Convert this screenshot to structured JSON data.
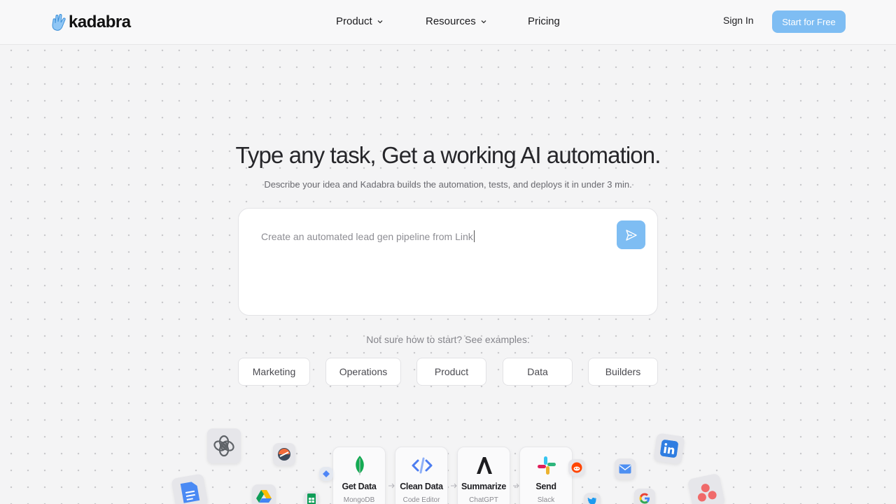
{
  "header": {
    "brand": "kadabra",
    "nav": [
      {
        "label": "Product",
        "has_dropdown": true
      },
      {
        "label": "Resources",
        "has_dropdown": true
      },
      {
        "label": "Pricing",
        "has_dropdown": false
      }
    ],
    "sign_in": "Sign In",
    "cta": "Start for Free"
  },
  "hero": {
    "title": "Type any task, Get a working AI automation.",
    "subtitle": "Describe your idea and Kadabra builds the automation, tests, and deploys it in under 3 min.",
    "prompt_value": "Create an automated lead gen pipeline from Link",
    "send_icon": "send-icon"
  },
  "examples": {
    "label": "Not sure how to start? See examples:",
    "chips": [
      "Marketing",
      "Operations",
      "Product",
      "Data",
      "Builders"
    ]
  },
  "workflow": [
    {
      "title": "Get Data",
      "app": "MongoDB",
      "icon": "mongodb-icon"
    },
    {
      "title": "Clean Data",
      "app": "Code Editor",
      "icon": "code-icon"
    },
    {
      "title": "Summarize",
      "app": "ChatGPT",
      "icon": "anthropic-icon"
    },
    {
      "title": "Send",
      "app": "Slack",
      "icon": "slack-icon"
    }
  ],
  "colors": {
    "accent": "#7ebdf3",
    "background": "#f4f4f5",
    "text_dark": "#26262a",
    "text_muted": "#6a6a70"
  }
}
